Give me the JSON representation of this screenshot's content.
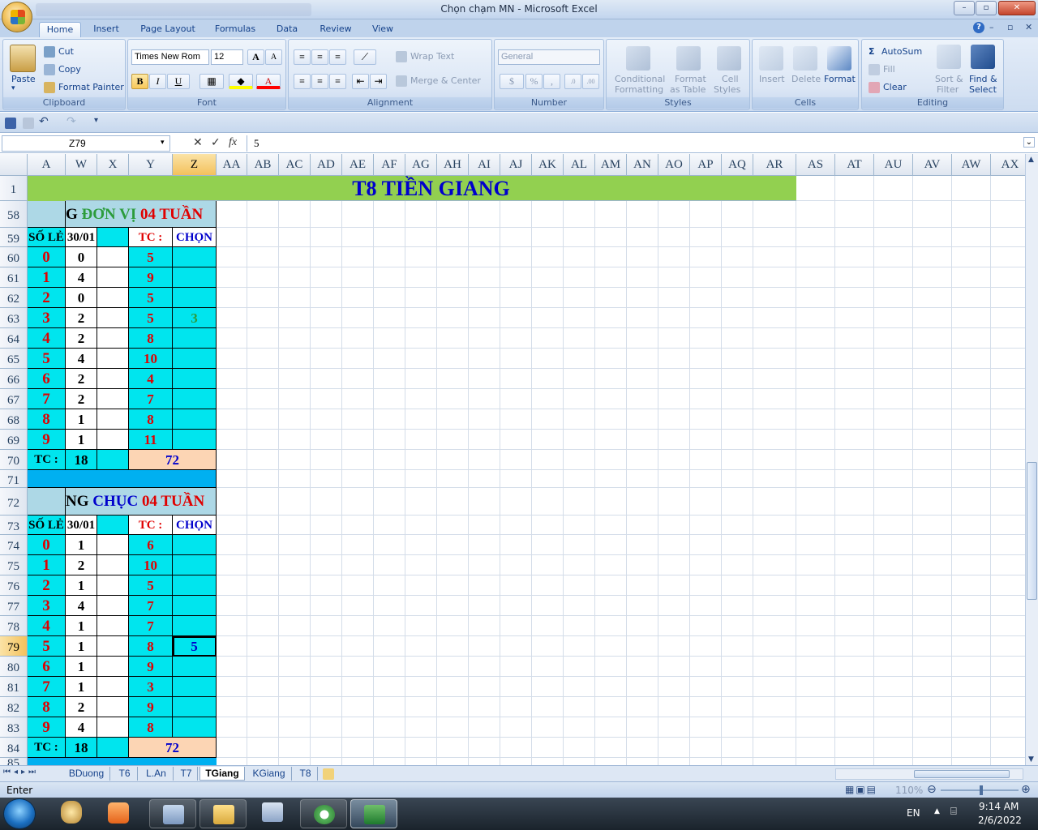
{
  "window": {
    "title": "Chọn chạm MN - Microsoft Excel",
    "min": "–",
    "max": "▫",
    "close": "✕"
  },
  "ribbon_tabs": [
    "Home",
    "Insert",
    "Page Layout",
    "Formulas",
    "Data",
    "Review",
    "View"
  ],
  "active_tab": "Home",
  "help": "?",
  "clipboard": {
    "paste": "Paste",
    "cut": "Cut",
    "copy": "Copy",
    "format_painter": "Format Painter",
    "label": "Clipboard"
  },
  "font": {
    "name": "Times New Rom",
    "size": "12",
    "bold": "B",
    "italic": "I",
    "underline": "U",
    "label": "Font",
    "grow": "A",
    "shrink": "A"
  },
  "alignment": {
    "wrap_text": "Wrap Text",
    "merge_center": "Merge & Center",
    "label": "Alignment"
  },
  "number": {
    "format": "General",
    "currency": "$",
    "percent": "%",
    "comma": ",",
    "label": "Number"
  },
  "styles": {
    "conditional": "Conditional",
    "conditional2": "Formatting",
    "format_table": "Format",
    "format_table2": "as Table",
    "cell_styles": "Cell",
    "cell_styles2": "Styles",
    "label": "Styles"
  },
  "cells": {
    "insert": "Insert",
    "delete": "Delete",
    "format": "Format",
    "label": "Cells"
  },
  "editing": {
    "autosum": "AutoSum",
    "fill": "Fill",
    "clear": "Clear",
    "sort": "Sort &",
    "sort2": "Filter",
    "find": "Find &",
    "find2": "Select",
    "label": "Editing"
  },
  "formula_bar": {
    "name_box": "Z79",
    "value": "5",
    "fx": "fx",
    "cancel": "✕",
    "enter": "✓"
  },
  "columns": [
    "A",
    "W",
    "X",
    "Y",
    "Z",
    "AA",
    "AB",
    "AC",
    "AD",
    "AE",
    "AF",
    "AG",
    "AH",
    "AI",
    "AJ",
    "AK",
    "AL",
    "AM",
    "AN",
    "AO",
    "AP",
    "AQ",
    "AR",
    "AS",
    "AT",
    "AU",
    "AV",
    "AW",
    "AX"
  ],
  "selected_column": "Z",
  "selected_row": "79",
  "rows": [
    "1",
    "58",
    "59",
    "60",
    "61",
    "62",
    "63",
    "64",
    "65",
    "66",
    "67",
    "68",
    "69",
    "70",
    "71",
    "72",
    "73",
    "74",
    "75",
    "76",
    "77",
    "78",
    "79",
    "80",
    "81",
    "82",
    "83",
    "84",
    "85"
  ],
  "sheet": {
    "banner": "T8 TIỀN GIANG",
    "block1": {
      "title_left": "ĐƠN VỊ",
      "title_right": "04 TUẦN",
      "title_prefix": "G ",
      "head_a": "SỐ LẺ",
      "head_w": "30/01",
      "head_y": "TC :",
      "head_z": "CHỌN",
      "digits": [
        "0",
        "1",
        "2",
        "3",
        "4",
        "5",
        "6",
        "7",
        "8",
        "9"
      ],
      "w": [
        "0",
        "4",
        "0",
        "2",
        "2",
        "4",
        "2",
        "2",
        "1",
        "1"
      ],
      "y": [
        "5",
        "9",
        "5",
        "5",
        "8",
        "10",
        "4",
        "7",
        "8",
        "11"
      ],
      "z": [
        "",
        "",
        "",
        "3",
        "",
        "",
        "",
        "",
        "",
        ""
      ],
      "tc_label": "TC :",
      "tc_w": "18",
      "tc_total": "72"
    },
    "block2": {
      "title_prefix": "NG",
      "title_left": "CHỤC",
      "title_right": "04 TUẦN",
      "head_a": "SỐ LẺ",
      "head_w": "30/01",
      "head_y": "TC :",
      "head_z": "CHỌN",
      "digits": [
        "0",
        "1",
        "2",
        "3",
        "4",
        "5",
        "6",
        "7",
        "8",
        "9"
      ],
      "w": [
        "1",
        "2",
        "1",
        "4",
        "1",
        "1",
        "1",
        "1",
        "2",
        "4"
      ],
      "y": [
        "6",
        "10",
        "5",
        "7",
        "7",
        "8",
        "9",
        "3",
        "9",
        "8"
      ],
      "z": [
        "",
        "",
        "",
        "",
        "",
        "5",
        "",
        "",
        "",
        ""
      ],
      "tc_label": "TC :",
      "tc_w": "18",
      "tc_total": "72"
    }
  },
  "sheet_tabs": [
    "BDuong",
    "T6",
    "L.An",
    "T7",
    "TGiang",
    "KGiang",
    "T8"
  ],
  "active_sheet": "TGiang",
  "status": {
    "mode": "Enter",
    "zoom": "110%"
  },
  "taskbar": {
    "lang": "EN",
    "time": "9:14 AM",
    "date": "2/6/2022"
  },
  "colors": {
    "cyan": "#00e5ee",
    "lightblue": "#add8e6",
    "red": "#ff0000",
    "green": "#92d050",
    "peach": "#fcd5b4",
    "blue": "#0000cc",
    "bar": "#00b0f0"
  }
}
